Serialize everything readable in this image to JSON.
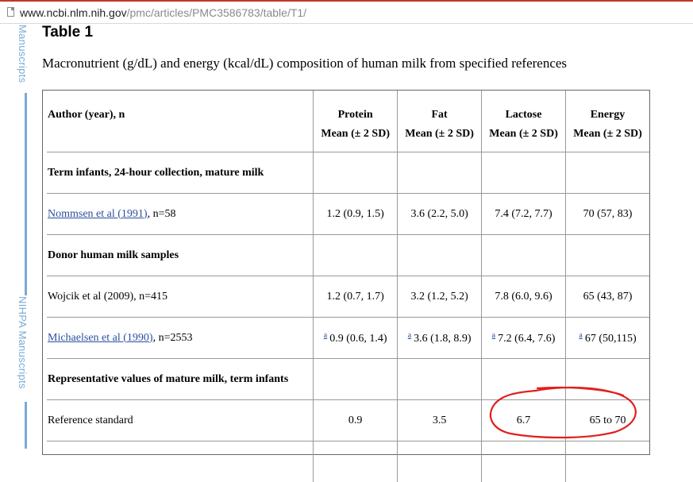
{
  "browser": {
    "url_host": "www.ncbi.nlm.nih.gov",
    "url_path": "/pmc/articles/PMC3586783/table/T1/"
  },
  "sidebar": {
    "label_top": "Manuscripts",
    "label_bottom": "NIHPA Manuscripts"
  },
  "colors": {
    "sidebar_blue": "#7aaad6",
    "link_blue": "#2b4f9e",
    "annotation_red": "#e02020"
  },
  "table": {
    "title": "Table 1",
    "caption": "Macronutrient (g/dL) and energy (kcal/dL) composition of human milk from specified references",
    "headers": {
      "author": "Author (year), n",
      "columns": [
        "Protein",
        "Fat",
        "Lactose",
        "Energy"
      ],
      "subheader": "Mean (± 2 SD)"
    },
    "rows": [
      {
        "kind": "section",
        "label": "Term infants, 24-hour collection, mature milk",
        "cells": [
          "",
          "",
          "",
          ""
        ]
      },
      {
        "kind": "data",
        "label_link": "Nommsen et al (1991)",
        "label_rest": ", n=58",
        "sup": "",
        "cells": [
          "1.2 (0.9, 1.5)",
          "3.6 (2.2, 5.0)",
          "7.4 (7.2, 7.7)",
          "70 (57, 83)"
        ]
      },
      {
        "kind": "section",
        "label": "Donor human milk samples",
        "cells": [
          "",
          "",
          "",
          ""
        ]
      },
      {
        "kind": "data",
        "label_link": "",
        "label_rest": "Wojcik et al (2009), n=415",
        "sup": "",
        "cells": [
          "1.2 (0.7, 1.7)",
          "3.2 (1.2, 5.2)",
          "7.8 (6.0, 9.6)",
          "65 (43, 87)"
        ]
      },
      {
        "kind": "data",
        "label_link": "Michaelsen et al (1990)",
        "label_rest": ", n=2553",
        "sup": "a",
        "cells": [
          "0.9 (0.6, 1.4)",
          "3.6 (1.8, 8.9)",
          "7.2 (6.4, 7.6)",
          "67 (50,115)"
        ]
      },
      {
        "kind": "section",
        "label": "Representative values of mature milk, term infants",
        "cells": [
          "",
          "",
          "",
          ""
        ]
      },
      {
        "kind": "data",
        "label_link": "",
        "label_rest": "Reference standard",
        "sup": "",
        "cells": [
          "0.9",
          "3.5",
          "6.7",
          "65 to 70"
        ]
      }
    ]
  }
}
